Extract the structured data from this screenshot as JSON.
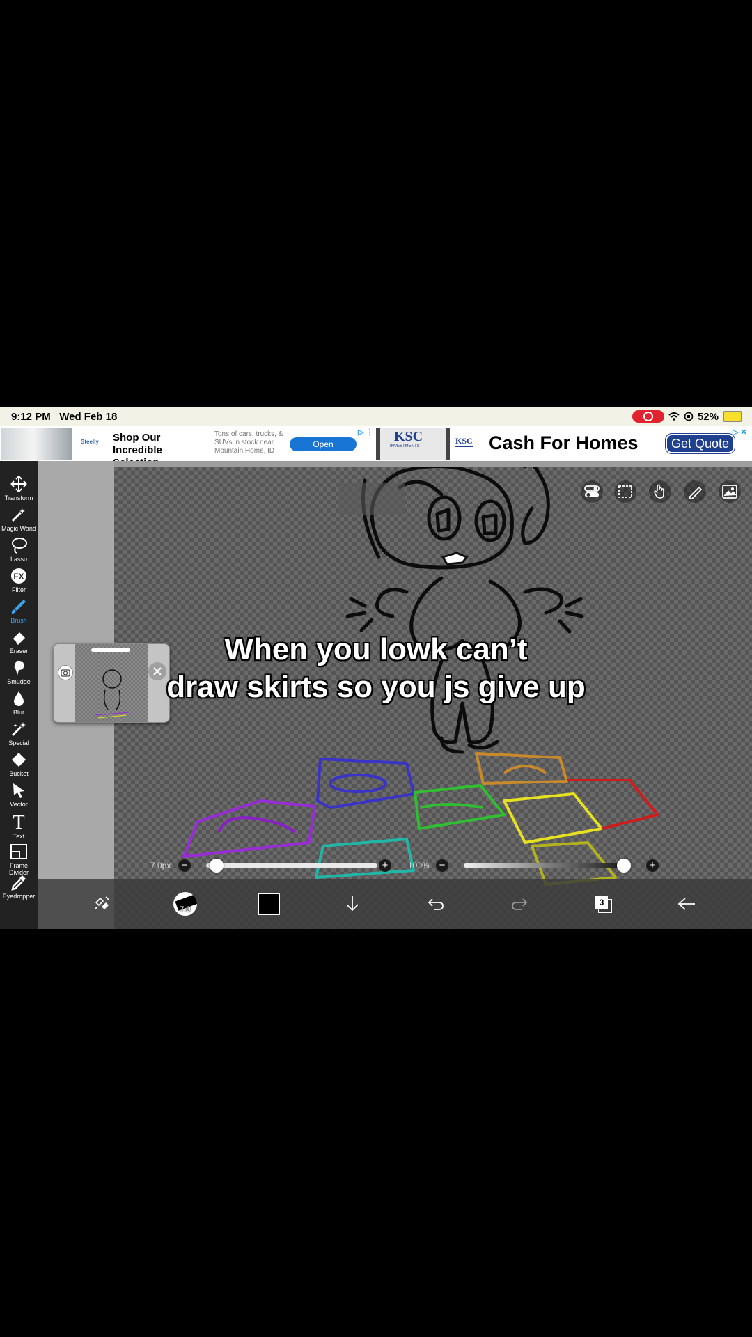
{
  "status": {
    "time": "9:12 PM",
    "date": "Wed Feb 18",
    "battery": "52%"
  },
  "ads": {
    "left": {
      "logo": "Steelly",
      "title": "Shop Our Incredible Selection",
      "description": "Tons of cars, trucks, & SUVs in stock near Mountain Home, ID",
      "button": "Open"
    },
    "right": {
      "banner_logo": "KSC",
      "banner_sub": "INVESTMENTS",
      "logo": "KSC",
      "title": "Cash For Homes",
      "button": "Get Quote"
    }
  },
  "tools": [
    {
      "label": "Transform",
      "icon": "move-icon"
    },
    {
      "label": "Magic Wand",
      "icon": "magic-wand-icon"
    },
    {
      "label": "Lasso",
      "icon": "lasso-icon"
    },
    {
      "label": "Filter",
      "icon": "fx-icon",
      "glyph": "FX"
    },
    {
      "label": "Brush",
      "icon": "brush-icon",
      "active": true
    },
    {
      "label": "Eraser",
      "icon": "eraser-icon"
    },
    {
      "label": "Smudge",
      "icon": "smudge-icon"
    },
    {
      "label": "Blur",
      "icon": "blur-drop-icon"
    },
    {
      "label": "Special",
      "icon": "special-icon"
    },
    {
      "label": "Bucket",
      "icon": "bucket-icon"
    },
    {
      "label": "Vector",
      "icon": "vector-arrow-icon"
    },
    {
      "label": "Text",
      "icon": "text-icon",
      "glyph": "T"
    },
    {
      "label": "Frame Divider",
      "icon": "frame-divider-icon"
    },
    {
      "label": "Eyedropper",
      "icon": "eyedropper-icon"
    }
  ],
  "caption": {
    "line1": "When you lowk can’t",
    "line2": "draw skirts so you js give up"
  },
  "sliders": {
    "brush_size": "7.0px",
    "opacity": "100%",
    "brush_size_value": 0.02,
    "opacity_value": 1.0
  },
  "bottombar": {
    "brush_size_badge": "7.0",
    "layer_count": "3",
    "color": "#000000"
  },
  "colors": {
    "accent": "#3ea4f0",
    "toolbar_bg": "#222222",
    "ad_button": "#1875d3",
    "quote_button": "#1f3f8f"
  }
}
